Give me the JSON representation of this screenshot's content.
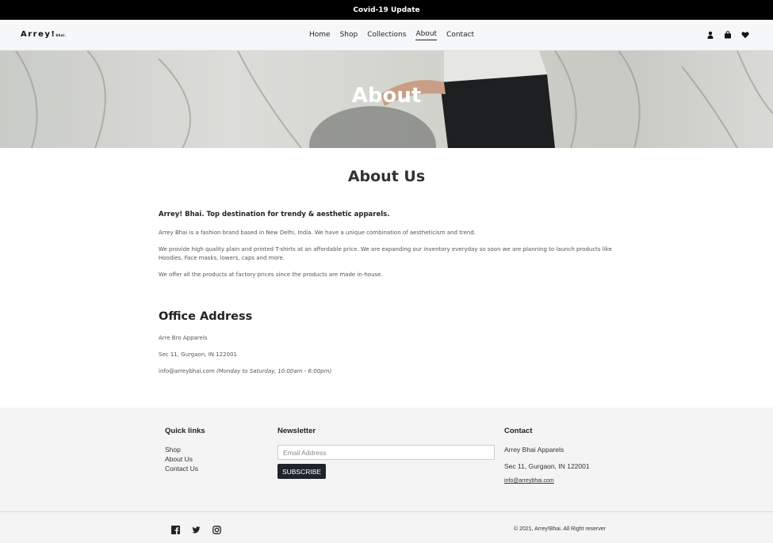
{
  "announcement": "Covid-19 Update",
  "brand": {
    "logo_main": "Arrey!",
    "logo_small": "bhai."
  },
  "nav": {
    "home": "Home",
    "shop": "Shop",
    "collections": "Collections",
    "about": "About",
    "contact": "Contact"
  },
  "header_icons": [
    "user-icon",
    "shopping-bag-icon",
    "heart-icon"
  ],
  "hero": {
    "title": "About"
  },
  "about": {
    "heading": "About Us",
    "tagline": "Arrey! Bhai. Top destination for trendy & aesthetic apparels.",
    "p1": "Arrey Bhai is a fashion brand based in New Delhi, India. We have a unique combination of aestheticism and trend.",
    "p2": "We provide high quality plain and printed T-shirts at an affordable price. We are expanding our inventory everyday so soon we are planning to launch products like Hoodies, Face masks, lowers, caps and more.",
    "p3": "We offer all the products at factory prices since the products are made in-house."
  },
  "office": {
    "heading": "Office Address",
    "name": "Arre Bro Apparels",
    "address": "Sec 11, Gurgaon, IN 122001",
    "email": "info@arreybhai.com",
    "hours": "(Monday to Saturday, 10:00am - 6:00pm)"
  },
  "footer": {
    "quick_links": {
      "heading": "Quick links",
      "items": [
        "Shop",
        "About Us",
        "Contact Us"
      ]
    },
    "newsletter": {
      "heading": "Newsletter",
      "placeholder": "Email Address",
      "button": "SUBSCRIBE"
    },
    "contact": {
      "heading": "Contact",
      "name": "Arrey Bhai Apparels",
      "address": "Sec 11, Gurgaon, IN 122001",
      "email": "info@arreybhai.com"
    },
    "social_icons": [
      "facebook-icon",
      "twitter-icon",
      "instagram-icon"
    ],
    "copyright": "© 2021, Arrey!Bhai. All Right reserver"
  }
}
